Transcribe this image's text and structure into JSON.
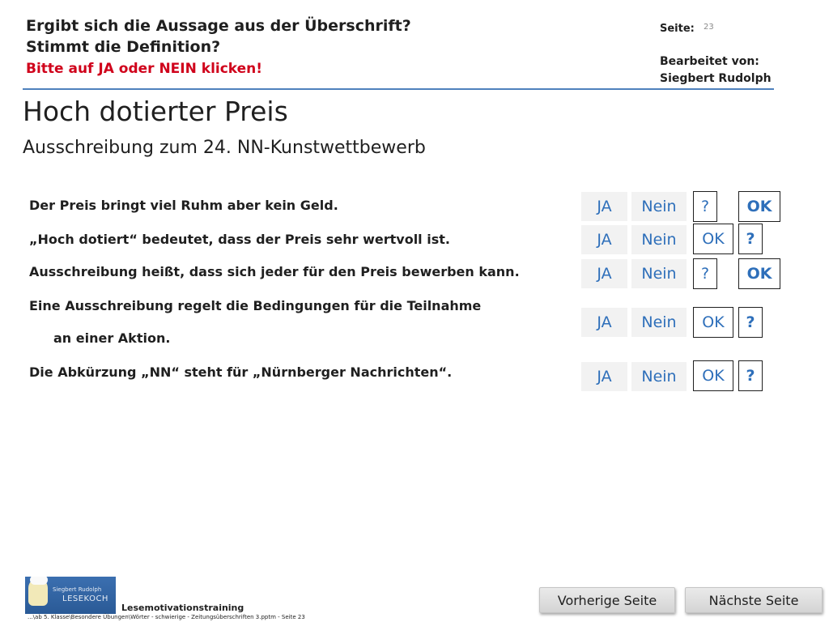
{
  "header": {
    "question1": "Ergibt sich die Aussage aus der Überschrift?",
    "question2": "Stimmt die Definition?",
    "instruction": "Bitte auf JA oder NEIN klicken!",
    "seite_label": "Seite:",
    "seite_number": "23",
    "bearbeitet_label": "Bearbeitet von:",
    "author": "Siegbert Rudolph",
    "accent_color": "#4f81bd",
    "instruction_color": "#d0021b"
  },
  "main": {
    "title": "Hoch dotierter Preis",
    "subtitle": "Ausschreibung zum 24. NN-Kunstwettbewerb",
    "statements": [
      "Der Preis bringt viel Ruhm aber kein Geld.",
      "„Hoch dotiert“ bedeutet, dass der Preis sehr wertvoll ist.",
      "Ausschreibung heißt, dass sich jeder für den Preis bewerben kann.",
      "Eine Ausschreibung regelt die Bedingungen für die Teilnahme",
      "an einer Aktion.",
      "Die Abkürzung „NN“ steht für „Nürnberger Nachrichten“."
    ],
    "answer_rows": [
      {
        "ja": "JA",
        "nein": "Nein",
        "box1": "?",
        "box2": "OK"
      },
      {
        "ja": "JA",
        "nein": "Nein",
        "box1": "OK",
        "box2": "?"
      },
      {
        "ja": "JA",
        "nein": "Nein",
        "box1": "?",
        "box2": "OK"
      },
      {
        "ja": "JA",
        "nein": "Nein",
        "box1": "OK",
        "box2": "?"
      },
      {
        "ja": "JA",
        "nein": "Nein",
        "box1": "OK",
        "box2": "?"
      }
    ],
    "button_text_color": "#2e6fba"
  },
  "footer": {
    "logo_line1": "Siegbert Rudolph",
    "logo_line2": "LESEKOCH",
    "label": "Lesemotivationstraining",
    "path": "...\\ab 5. Klasse\\Besondere Übungen\\Wörter - schwierige - Zeitungsüberschriften 3.pptm - Seite 23",
    "prev_button": "Vorherige Seite",
    "next_button": "Nächste Seite"
  }
}
